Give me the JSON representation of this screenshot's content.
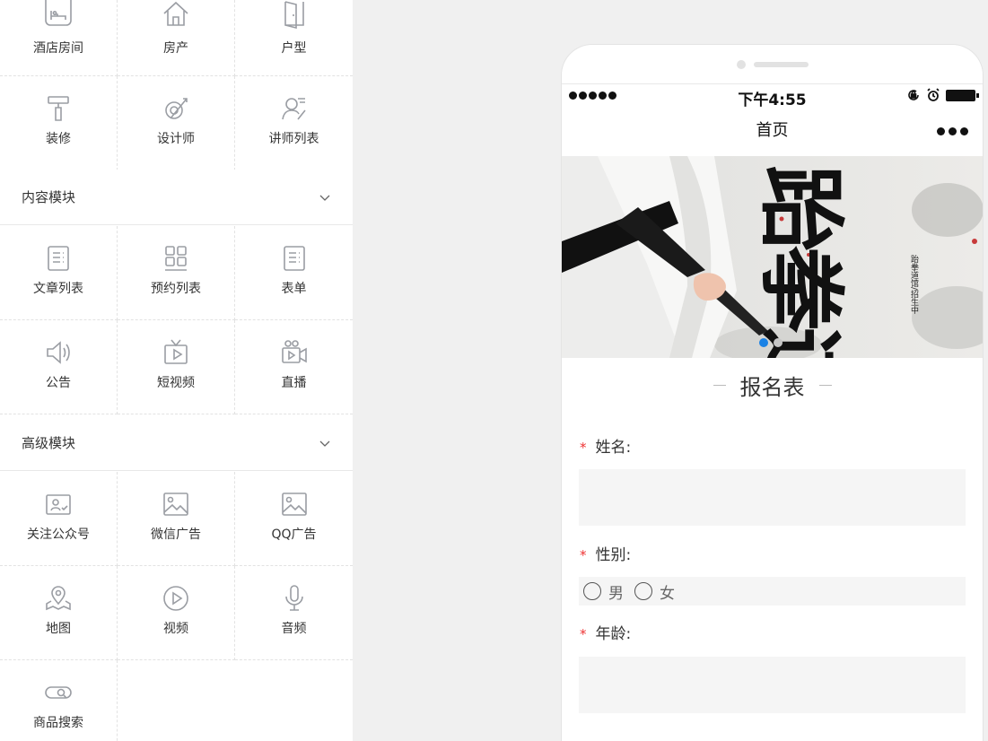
{
  "basic": {
    "items": [
      {
        "label": "酒店房间",
        "icon": "hotel-bed-icon"
      },
      {
        "label": "房产",
        "icon": "house-icon"
      },
      {
        "label": "户型",
        "icon": "door-icon"
      },
      {
        "label": "装修",
        "icon": "paint-roller-icon"
      },
      {
        "label": "设计师",
        "icon": "designer-brush-icon"
      },
      {
        "label": "讲师列表",
        "icon": "lecturer-icon"
      }
    ]
  },
  "content_section": {
    "title": "内容模块",
    "items": [
      {
        "label": "文章列表",
        "icon": "article-list-icon"
      },
      {
        "label": "预约列表",
        "icon": "grid-list-icon"
      },
      {
        "label": "表单",
        "icon": "form-icon"
      },
      {
        "label": "公告",
        "icon": "speaker-icon"
      },
      {
        "label": "短视频",
        "icon": "tv-icon"
      },
      {
        "label": "直播",
        "icon": "live-camera-icon"
      }
    ]
  },
  "advanced_section": {
    "title": "高级模块",
    "items": [
      {
        "label": "关注公众号",
        "icon": "follow-account-icon"
      },
      {
        "label": "微信广告",
        "icon": "image-icon"
      },
      {
        "label": "QQ广告",
        "icon": "image-icon"
      },
      {
        "label": "地图",
        "icon": "map-icon"
      },
      {
        "label": "视频",
        "icon": "play-icon"
      },
      {
        "label": "音频",
        "icon": "microphone-icon"
      },
      {
        "label": "商品搜索",
        "icon": "search-toggle-icon"
      }
    ]
  },
  "phone": {
    "status": {
      "time": "下午4:55"
    },
    "nav_title": "首页",
    "banner": {
      "title": "跆拳道",
      "subtitle": "跆拳道馆/招生中",
      "active_slide": 1,
      "slide_count": 2
    },
    "form": {
      "title": "报名表",
      "fields": [
        {
          "label": "姓名:",
          "required": true,
          "value": ""
        },
        {
          "label": "性别:",
          "required": true,
          "options": [
            "男",
            "女"
          ]
        },
        {
          "label": "年龄:",
          "required": true,
          "value": ""
        }
      ],
      "required_mark": "*"
    }
  },
  "colors": {
    "accent": "#1a82e5",
    "required": "#ee3333",
    "input_bg": "#f5f5f5",
    "icon": "#9a9da3"
  }
}
